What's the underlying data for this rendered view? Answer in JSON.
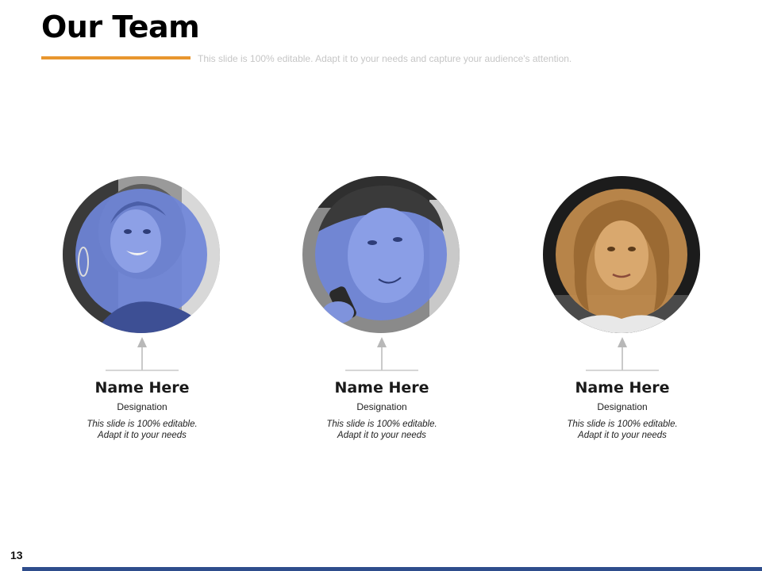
{
  "slide": {
    "title": "Our Team",
    "subtitle": "This slide is 100% editable. Adapt it to your needs and capture your audience's attention.",
    "page_number": "13",
    "accent_color": "#e8962e",
    "footer_color": "#2e4d8c"
  },
  "members": [
    {
      "name": "Name Here",
      "designation": "Designation",
      "desc_line1": "This slide is 100% editable.",
      "desc_line2": "Adapt it to your needs",
      "photo_tint": "#6f86d9"
    },
    {
      "name": "Name Here",
      "designation": "Designation",
      "desc_line1": "This slide is 100% editable.",
      "desc_line2": "Adapt it to your needs",
      "photo_tint": "#6f86d9"
    },
    {
      "name": "Name Here",
      "designation": "Designation",
      "desc_line1": "This slide is 100% editable.",
      "desc_line2": "Adapt it to your needs",
      "photo_tint": "#c08a4c"
    }
  ]
}
